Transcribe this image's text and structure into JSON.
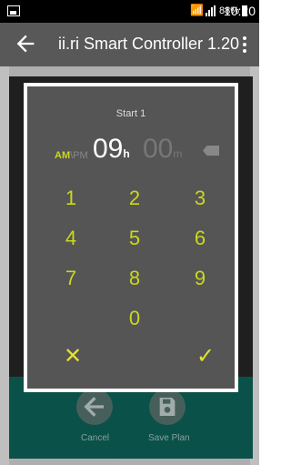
{
  "status": {
    "battery": "88%",
    "time": "10:20"
  },
  "appbar": {
    "title": "ii.ri Smart Controller 1.20"
  },
  "bottom_actions": {
    "cancel": "Cancel",
    "save": "Save Plan"
  },
  "dialog": {
    "label": "Start 1",
    "am": "AM",
    "pm": "PM",
    "hours": "09",
    "hours_unit": "h",
    "minutes": "00",
    "minutes_unit": "m",
    "keys": [
      "1",
      "2",
      "3",
      "4",
      "5",
      "6",
      "7",
      "8",
      "9",
      "0"
    ],
    "cancel_symbol": "✕",
    "ok_symbol": "✓"
  },
  "colors": {
    "accent": "#c8d91d",
    "teal": "#0e6d62",
    "appbar": "#585858"
  }
}
